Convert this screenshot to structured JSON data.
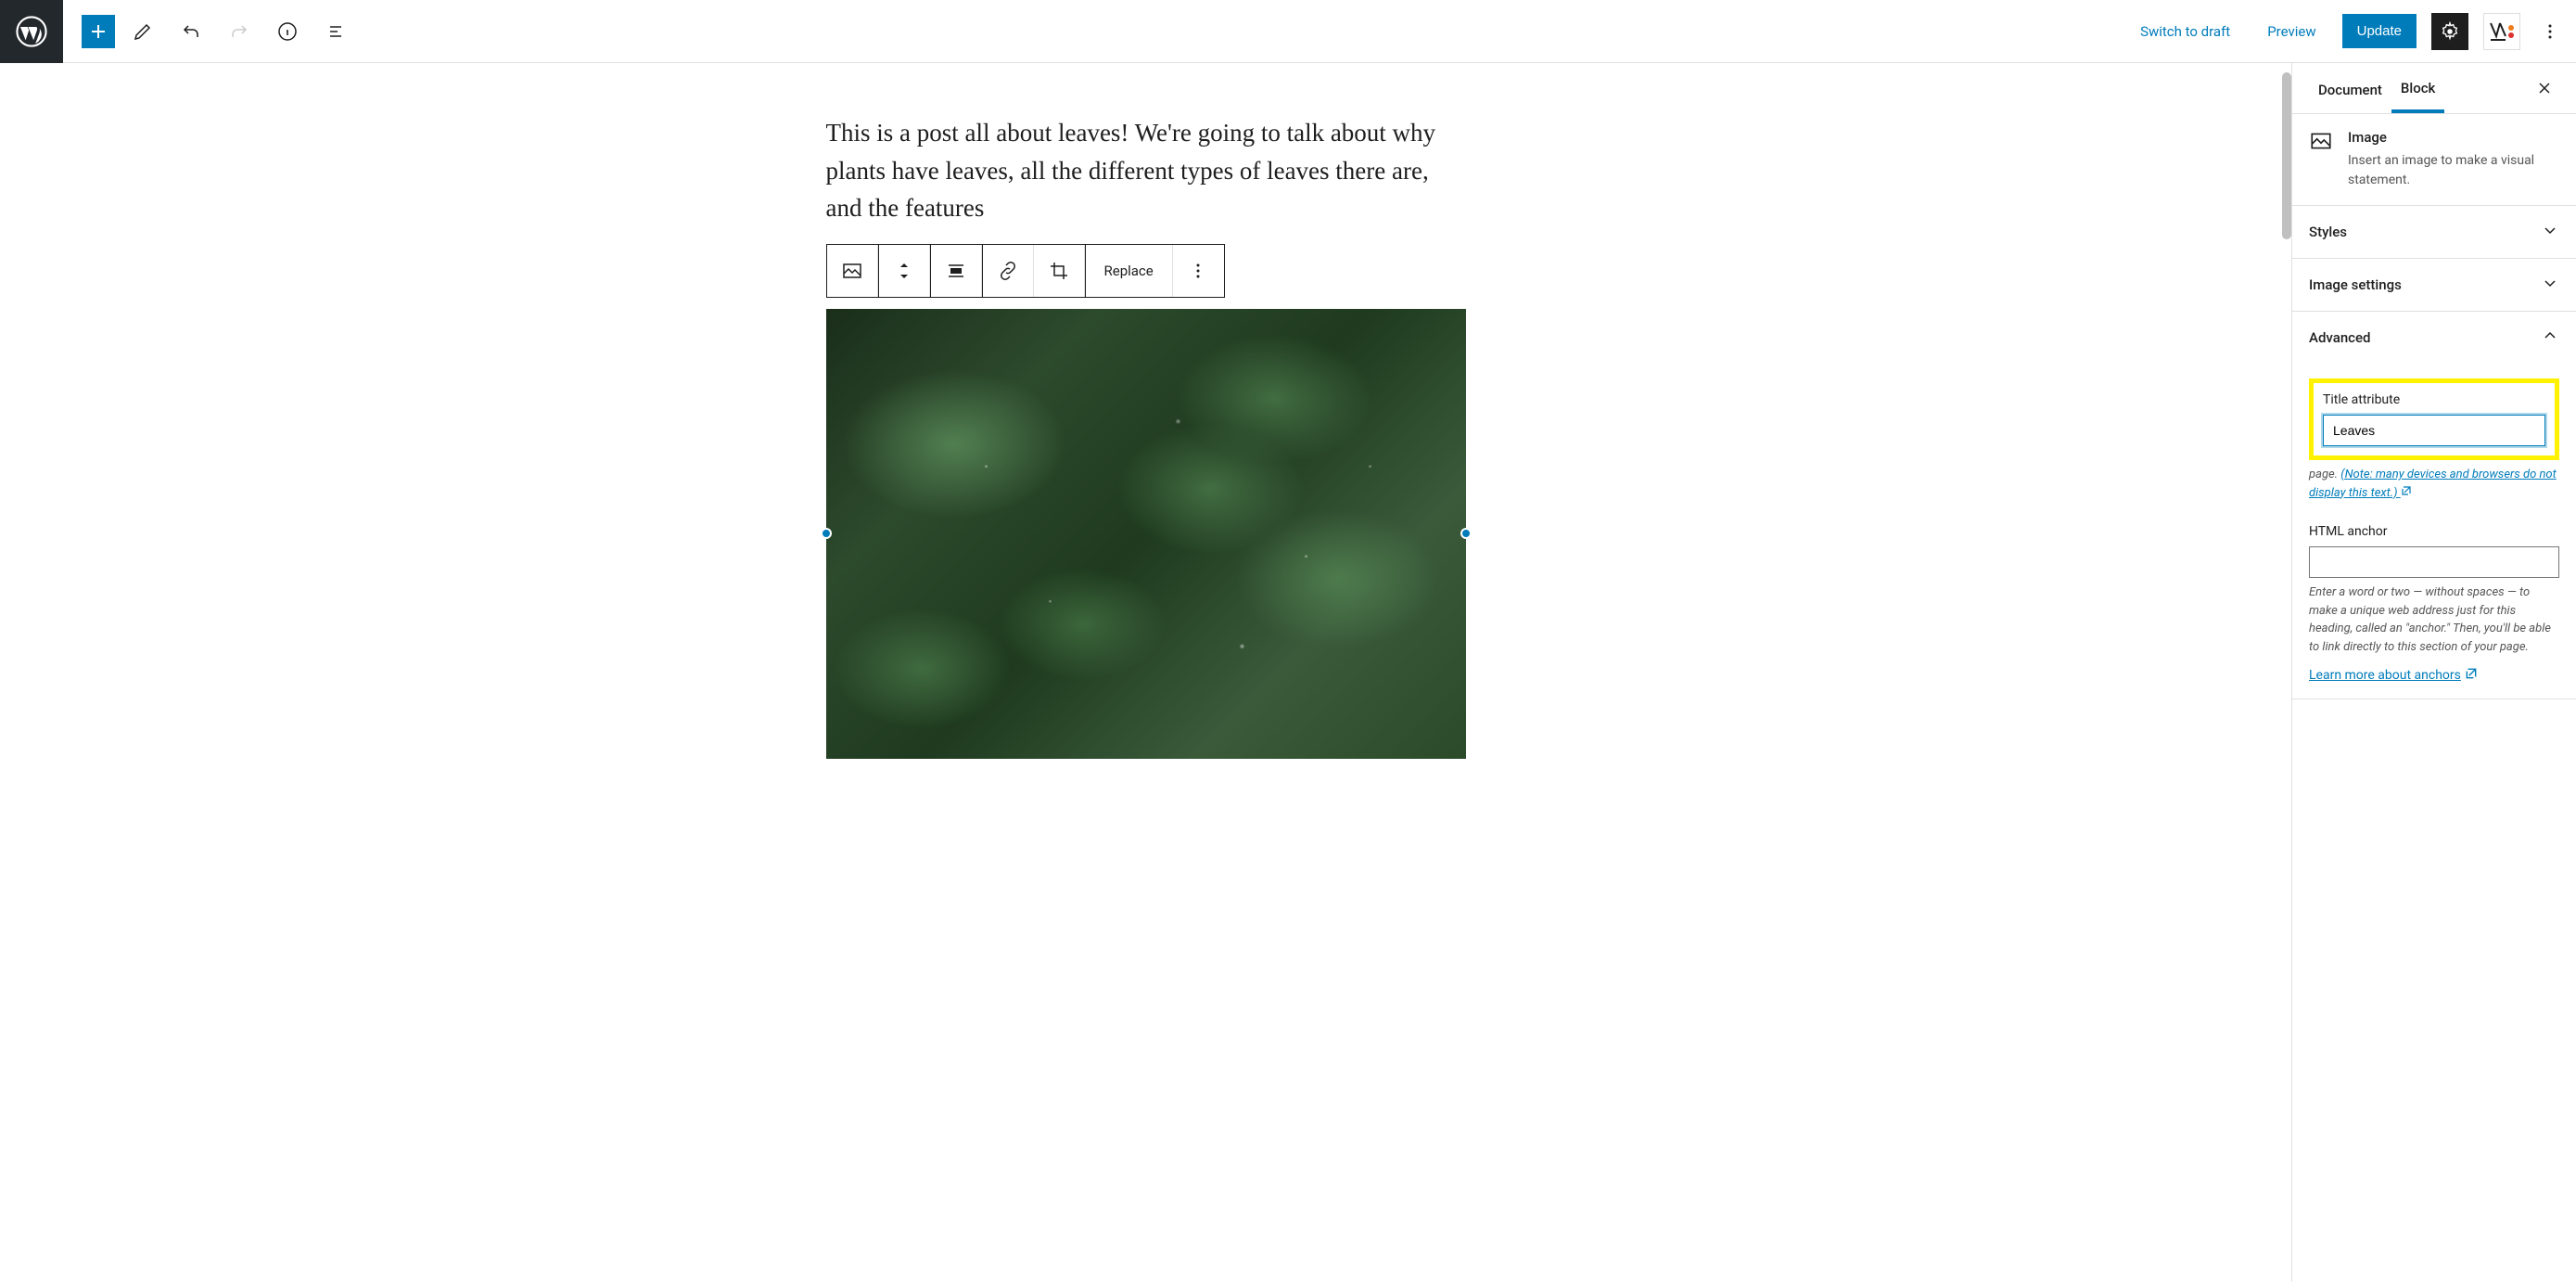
{
  "toolbar": {
    "switch_to_draft": "Switch to draft",
    "preview": "Preview",
    "update": "Update"
  },
  "post": {
    "body": "This is a post all about leaves! We're going to talk about why plants have leaves, all the different types of leaves there are, and the features"
  },
  "block_toolbar": {
    "replace": "Replace"
  },
  "sidebar": {
    "tabs": {
      "document": "Document",
      "block": "Block"
    },
    "block_info": {
      "title": "Image",
      "desc": "Insert an image to make a visual statement."
    },
    "panels": {
      "styles": "Styles",
      "image_settings": "Image settings",
      "advanced": "Advanced"
    },
    "advanced": {
      "title_label": "Title attribute",
      "title_value": "Leaves",
      "title_help_prefix": "page.",
      "title_help_link": "(Note: many devices and browsers do not display this text.)",
      "anchor_label": "HTML anchor",
      "anchor_value": "",
      "anchor_help": "Enter a word or two — without spaces — to make a unique web address just for this heading, called an \"anchor.\" Then, you'll be able to link directly to this section of your page.",
      "anchor_learn": "Learn more about anchors"
    }
  }
}
